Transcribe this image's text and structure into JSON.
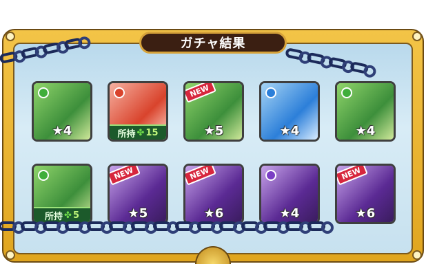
{
  "title": "ガチャ結果",
  "owned_label": "所持",
  "clover_icon": "clover-icon",
  "star_icon": "star-icon",
  "colors": {
    "frame": "#e0a51f",
    "panel": "#c7e1ef",
    "chain": "#1c2a5a",
    "new_badge": "#d7263d",
    "owned_bar": "#1c5a2b"
  },
  "cards": [
    {
      "stars": "★4",
      "element": "wood",
      "new": false,
      "owned": null,
      "new_label": ""
    },
    {
      "stars": "",
      "element": "fire",
      "new": false,
      "owned": "15",
      "new_label": ""
    },
    {
      "stars": "★5",
      "element": "wood",
      "new": true,
      "owned": null,
      "new_label": "NEW"
    },
    {
      "stars": "★4",
      "element": "water",
      "new": false,
      "owned": null,
      "new_label": ""
    },
    {
      "stars": "★4",
      "element": "wood",
      "new": false,
      "owned": null,
      "new_label": ""
    },
    {
      "stars": "",
      "element": "wood",
      "new": false,
      "owned": "5",
      "new_label": ""
    },
    {
      "stars": "★5",
      "element": "dark",
      "new": true,
      "owned": null,
      "new_label": "NEW"
    },
    {
      "stars": "★6",
      "element": "dark",
      "new": true,
      "owned": null,
      "new_label": "NEW"
    },
    {
      "stars": "★4",
      "element": "dark",
      "new": false,
      "owned": null,
      "new_label": ""
    },
    {
      "stars": "★6",
      "element": "dark",
      "new": true,
      "owned": null,
      "new_label": "NEW"
    }
  ]
}
